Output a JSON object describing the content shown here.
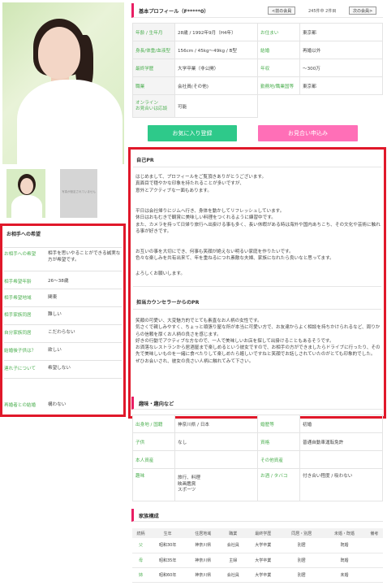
{
  "photo": {
    "watermark": "Sample"
  },
  "thumbs": {
    "placeholder": "写真が設定されていません"
  },
  "preference": {
    "title": "お相手への希望",
    "rows": [
      {
        "label": "お相手への希望",
        "value": "相手を思いやることができる誠実な方が希望です。"
      },
      {
        "label": "相手希望年齢",
        "value": "26〜38歳"
      },
      {
        "label": "相手希望地域",
        "value": "関東"
      },
      {
        "label": "相手家族同居",
        "value": "難しい"
      },
      {
        "label": "自分家族同居",
        "value": "こだわらない"
      },
      {
        "label": "結婚後子供は？",
        "value": "欲しい"
      },
      {
        "label": "連れ子について",
        "value": "希望しない"
      },
      {
        "label": "再婚者との結婚",
        "value": "構わない"
      }
    ]
  },
  "header": {
    "title": "基本プロフィール（F*****0）",
    "prev_label": "<前の会員",
    "count": "245件中 2件目",
    "next_label": "次の会員>"
  },
  "basic": {
    "rows": [
      [
        {
          "label": "年齢 / 生年月",
          "value": "28歳 / 1992年9月（H4年）"
        },
        {
          "label": "お住まい",
          "value": "東京都"
        }
      ],
      [
        {
          "label": "身長/体重/血液型",
          "value": "156cm / 45kg〜49kg / B型"
        },
        {
          "label": "結婚",
          "value": "再婚以外"
        }
      ],
      [
        {
          "label": "最終学歴",
          "value": "大学卒業（非公開）"
        },
        {
          "label": "年収",
          "value": "〜300万"
        }
      ],
      [
        {
          "label": "職業",
          "value": "会社員(その他)"
        },
        {
          "label": "勤務地/職業国等",
          "value": "東京都"
        }
      ],
      [
        {
          "label": "オンライン\nお見合いは応談",
          "value": "可能"
        }
      ]
    ]
  },
  "actions": {
    "favorite": "お気に入り登録",
    "omiai": "お見合い申込み"
  },
  "self_pr": {
    "title": "自己PR",
    "p1": "はじめまして、プロフィールをご覧頂きありがとうございます。\n真面目で穏やかな印象を持たれることが多いですが、\n意外とアクティブな一面もあります。",
    "p2": "平日は会社帰りにジムへ行き、身体を動かしてリフレッシュしています。\n休日はおもむきで観賞に美味しい料理をつくれるように練習中です。\nまた、カメラを持って日帰り旅行へ出掛ける事も多く、長い休暇がある時は海外や国内あちこち、その文化や芸術に触れる事が好きです。",
    "p3": "お互いの事を大切にでき、何事も笑顔が絶えない明るい家庭を作りたいです。\n色々な楽しみを共有出来て、年を重ねるにつれ素敵な夫婦、家族になれたら良いなと思ってます。",
    "p4": "よろしくお願いします。"
  },
  "counselor_pr": {
    "title": "担当カウンセラーからのPR",
    "text": "笑顔の可愛い、大変魅力的でとても素直なお人柄の女性です。\n気さくで親しみやすく、ちょっと頑張り屋な所が本当に可愛い方で、お友達からよく相談を持ちかけられるなど、周りからの信頼を厚くお人柄の良さを感じます。\n好きの行動でアクティブな方なので、一人で美味しいお店を探して出掛けることもあるそうです。\nお洒落なレストランから居酒屋まで楽しめるという彼女ですので、お相手の方ができましたらドライブに行ったり、その先で美味しいものを一緒に食べたりして楽しめたら嬉しいですねと笑顔でお話しされていたのがとても印象的でした。\nぜひお会いされ、彼女の良さい人柄に触れてみて下さい。"
  },
  "hobby": {
    "title": "趣味・趣向など",
    "rows": [
      [
        {
          "label": "出身地 / 国籍",
          "value": "神奈川県 / 日本"
        },
        {
          "label": "婚歴等",
          "value": "初婚"
        }
      ],
      [
        {
          "label": "子供",
          "value": "なし"
        },
        {
          "label": "資格",
          "value": "普通自動車運転免許"
        }
      ],
      [
        {
          "label": "本人資産",
          "value": ""
        },
        {
          "label": "その他資産",
          "value": ""
        }
      ],
      [
        {
          "label": "趣味",
          "value": "旅行、料理\n映画鑑賞\nスポーツ"
        },
        {
          "label": "お酒 / タバコ",
          "value": "付き合い程度 / 吸わない"
        }
      ]
    ]
  },
  "family": {
    "title": "家族構成",
    "headers": [
      "続柄",
      "生年",
      "住居地域",
      "職業",
      "最終学歴",
      "同居・別居",
      "未婚・既婚",
      "備考"
    ],
    "rows": [
      [
        "父",
        "昭和30年",
        "神奈川県",
        "会社員",
        "大学卒業",
        "別居",
        "既婚",
        ""
      ],
      [
        "母",
        "昭和35年",
        "神奈川県",
        "主婦",
        "大学卒業",
        "別居",
        "既婚",
        ""
      ],
      [
        "姉",
        "昭和60年",
        "神奈川県",
        "会社員",
        "大学卒業",
        "別居",
        "未婚",
        ""
      ]
    ]
  }
}
